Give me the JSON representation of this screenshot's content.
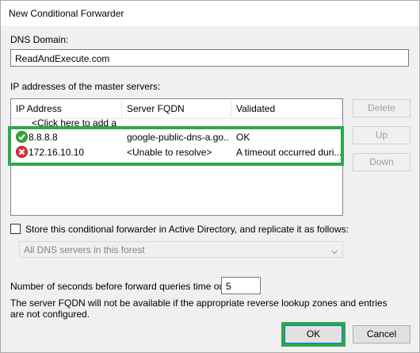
{
  "window": {
    "title": "New Conditional Forwarder"
  },
  "dns_domain": {
    "label": "DNS Domain:",
    "value": "ReadAndExecute.com"
  },
  "master_servers": {
    "label": "IP addresses of the master servers:",
    "columns": [
      "IP Address",
      "Server FQDN",
      "Validated"
    ],
    "add_prompt": "<Click here to add a",
    "rows": [
      {
        "status": "ok",
        "status_icon": "check-circle-icon",
        "ip": "8.8.8.8",
        "fqdn": "google-public-dns-a.go...",
        "validated": "OK"
      },
      {
        "status": "error",
        "status_icon": "error-circle-icon",
        "ip": "172.16.10.10",
        "fqdn": "<Unable to resolve>",
        "validated": "A timeout occurred duri..."
      }
    ]
  },
  "side_buttons": {
    "delete": "Delete",
    "up": "Up",
    "down": "Down"
  },
  "store_ad": {
    "label": "Store this conditional forwarder in Active Directory, and replicate it as follows:",
    "checked": false,
    "replication_selected": "All DNS servers in this forest"
  },
  "timeout": {
    "label": "Number of seconds before forward queries time out:",
    "value": "5"
  },
  "note": "The server FQDN will not be available if the appropriate reverse lookup zones and entries are not configured.",
  "footer": {
    "ok": "OK",
    "cancel": "Cancel"
  },
  "colors": {
    "highlight": "#2ea84a",
    "ok_icon": "#3aa53a",
    "error_icon": "#d9363e"
  }
}
